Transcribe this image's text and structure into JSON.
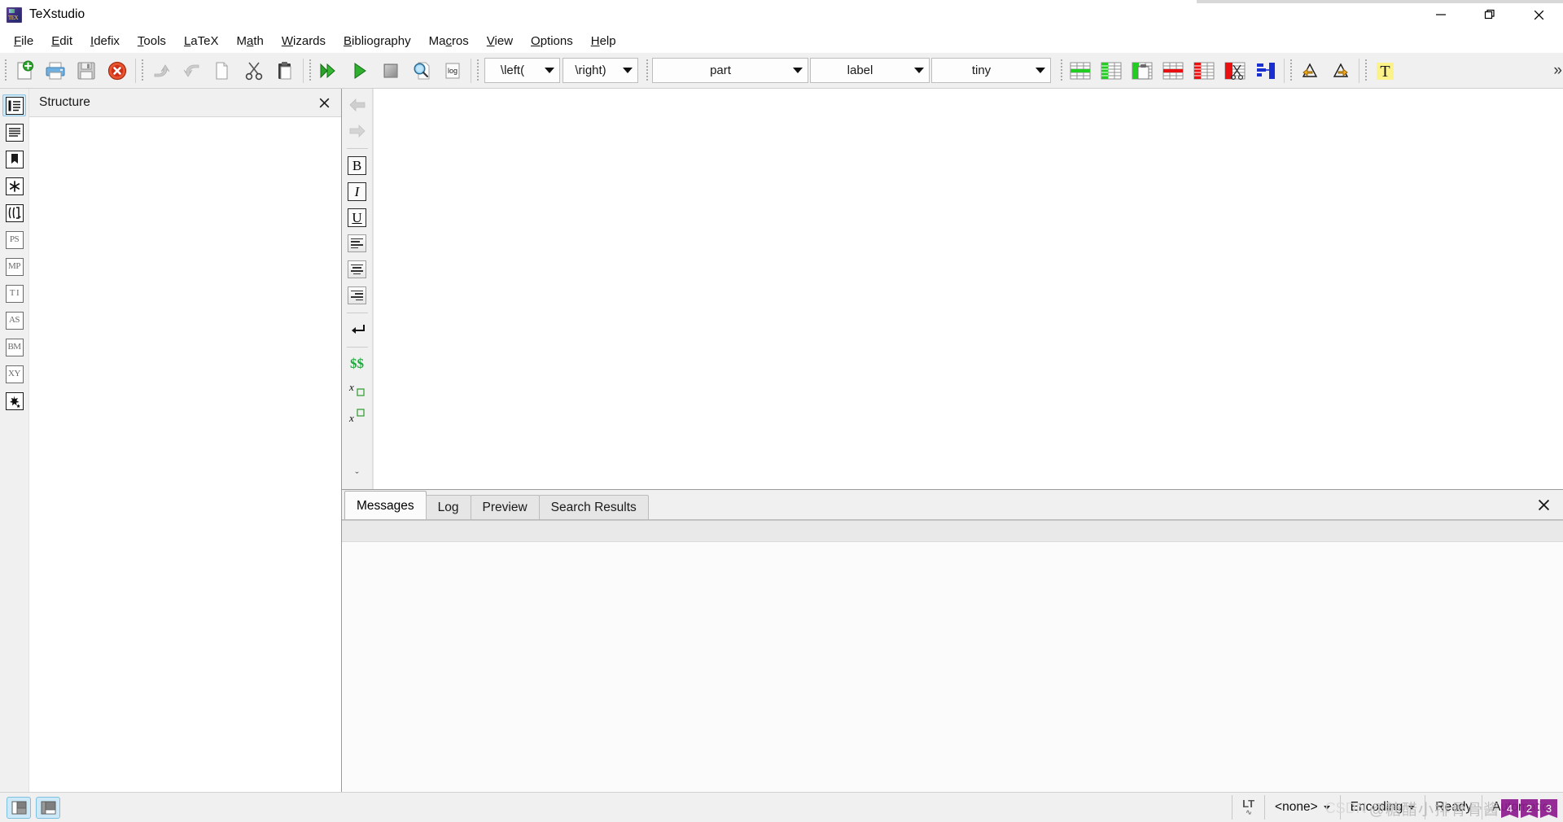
{
  "window": {
    "title": "TeXstudio",
    "app_icon": "texstudio-logo-icon",
    "controls": {
      "minimize": "minimize-icon",
      "restore": "restore-icon",
      "close": "close-icon"
    }
  },
  "menubar": {
    "items": [
      {
        "label": "File",
        "mnemonic": "F"
      },
      {
        "label": "Edit",
        "mnemonic": "E"
      },
      {
        "label": "Idefix",
        "mnemonic": "I"
      },
      {
        "label": "Tools",
        "mnemonic": "T"
      },
      {
        "label": "LaTeX",
        "mnemonic": "L"
      },
      {
        "label": "Math",
        "mnemonic": "a"
      },
      {
        "label": "Wizards",
        "mnemonic": "W"
      },
      {
        "label": "Bibliography",
        "mnemonic": "B"
      },
      {
        "label": "Macros",
        "mnemonic": "c"
      },
      {
        "label": "View",
        "mnemonic": "V"
      },
      {
        "label": "Options",
        "mnemonic": "O"
      },
      {
        "label": "Help",
        "mnemonic": "H"
      }
    ]
  },
  "toolbar": {
    "groups": [
      {
        "name": "file-group",
        "buttons": [
          {
            "name": "new-document-button",
            "icon": "new-document-icon",
            "tooltip": "New"
          },
          {
            "name": "print-button",
            "icon": "printer-icon",
            "tooltip": "Print"
          },
          {
            "name": "save-button",
            "icon": "floppy-save-icon",
            "tooltip": "Save"
          },
          {
            "name": "close-document-button",
            "icon": "red-close-circle-icon",
            "tooltip": "Close"
          }
        ]
      },
      {
        "name": "edit-group",
        "buttons": [
          {
            "name": "undo-button",
            "icon": "undo-arrow-icon",
            "tooltip": "Undo",
            "disabled": true
          },
          {
            "name": "redo-button",
            "icon": "redo-arrow-icon",
            "tooltip": "Redo",
            "disabled": true
          },
          {
            "name": "copy-button",
            "icon": "copy-pages-icon",
            "tooltip": "Copy"
          },
          {
            "name": "cut-button",
            "icon": "scissors-icon",
            "tooltip": "Cut"
          },
          {
            "name": "paste-button",
            "icon": "clipboard-paste-icon",
            "tooltip": "Paste"
          }
        ]
      },
      {
        "name": "build-group",
        "buttons": [
          {
            "name": "build-and-view-button",
            "icon": "double-green-arrow-icon",
            "tooltip": "Build & View"
          },
          {
            "name": "compile-button",
            "icon": "green-play-arrow-icon",
            "tooltip": "Compile"
          },
          {
            "name": "stop-button",
            "icon": "gray-stop-square-icon",
            "tooltip": "Stop"
          },
          {
            "name": "view-log-button",
            "icon": "magnifier-page-icon",
            "tooltip": "View Log"
          },
          {
            "name": "log-button",
            "icon": "log-page-icon",
            "tooltip": "Log",
            "label": "log"
          }
        ]
      }
    ],
    "combos": [
      {
        "name": "left-bracket-combo",
        "value": "\\left(",
        "size": "sm"
      },
      {
        "name": "right-bracket-combo",
        "value": "\\right)",
        "size": "sm"
      },
      {
        "name": "section-level-combo",
        "value": "part",
        "size": "lg"
      },
      {
        "name": "label-combo",
        "value": "label",
        "size": "md"
      },
      {
        "name": "font-size-combo",
        "value": "tiny",
        "size": "md"
      }
    ],
    "table_buttons": [
      {
        "name": "insert-table-row-button",
        "icon": "table-green-row-icon"
      },
      {
        "name": "insert-table-column-button",
        "icon": "table-green-column-icon"
      },
      {
        "name": "paste-table-column-button",
        "icon": "table-green-column-paste-icon"
      },
      {
        "name": "remove-table-row-button",
        "icon": "table-red-row-icon"
      },
      {
        "name": "remove-table-column-button",
        "icon": "table-red-column-icon"
      },
      {
        "name": "cut-table-column-button",
        "icon": "table-red-column-scissors-icon"
      },
      {
        "name": "align-table-columns-button",
        "icon": "table-blue-align-icon"
      }
    ],
    "delta_buttons": [
      {
        "name": "previous-change-button",
        "icon": "triangle-left-arrow-icon"
      },
      {
        "name": "next-change-button",
        "icon": "triangle-right-arrow-icon"
      }
    ],
    "highlight_button": {
      "name": "text-highlight-button",
      "icon": "yellow-highlight-T-icon",
      "label": "T"
    },
    "overflow": {
      "name": "toolbar-overflow-button",
      "label": "»"
    }
  },
  "rail": {
    "items": [
      {
        "name": "sidebar-structure-view",
        "icon": "structure-list-icon",
        "label": "",
        "selected": true
      },
      {
        "name": "sidebar-text-lines-view",
        "icon": "text-lines-icon",
        "label": ""
      },
      {
        "name": "sidebar-bookmarks-view",
        "icon": "bookmark-icon",
        "label": ""
      },
      {
        "name": "sidebar-symbols-view",
        "icon": "asterisk-symbol-icon",
        "label": "✱"
      },
      {
        "name": "sidebar-brackets-view",
        "icon": "brackets-icon",
        "label": "(⟦·"
      },
      {
        "name": "sidebar-ps-symbols",
        "icon": "ps-symbols-icon",
        "label": "PS"
      },
      {
        "name": "sidebar-mp-symbols",
        "icon": "mp-symbols-icon",
        "label": "MP"
      },
      {
        "name": "sidebar-ti-symbols",
        "icon": "ti-symbols-icon",
        "label": "T I"
      },
      {
        "name": "sidebar-as-symbols",
        "icon": "as-symbols-icon",
        "label": "AS"
      },
      {
        "name": "sidebar-bm-symbols",
        "icon": "bm-symbols-icon",
        "label": "BM"
      },
      {
        "name": "sidebar-xy-symbols",
        "icon": "xy-symbols-icon",
        "label": "XY"
      },
      {
        "name": "sidebar-favorite-symbols",
        "icon": "star-sparkle-icon",
        "label": ""
      }
    ]
  },
  "structure_panel": {
    "title": "Structure",
    "close_icon": "close-icon",
    "items": []
  },
  "format_toolbar": {
    "buttons": [
      {
        "name": "navigate-back-button",
        "icon": "back-arrow-icon",
        "disabled": true
      },
      {
        "name": "navigate-forward-button",
        "icon": "forward-arrow-icon",
        "disabled": true
      },
      {
        "name": "bold-button",
        "icon": "bold-icon",
        "label": "B"
      },
      {
        "name": "italic-button",
        "icon": "italic-icon",
        "label": "I"
      },
      {
        "name": "underline-button",
        "icon": "underline-icon",
        "label": "U"
      },
      {
        "name": "align-left-button",
        "icon": "align-left-icon"
      },
      {
        "name": "align-center-button",
        "icon": "align-center-icon"
      },
      {
        "name": "align-right-button",
        "icon": "align-right-icon"
      },
      {
        "name": "insert-newline-button",
        "icon": "return-arrow-icon"
      },
      {
        "name": "inline-math-button",
        "icon": "dollar-dollar-icon",
        "label": "$$"
      },
      {
        "name": "subscript-button",
        "icon": "subscript-icon",
        "label": "x□"
      },
      {
        "name": "superscript-button",
        "icon": "superscript-icon",
        "label": "x□"
      },
      {
        "name": "expand-format-toolbar-button",
        "icon": "chevron-down-icon",
        "label": "ˇ"
      }
    ]
  },
  "message_panel": {
    "tabs": [
      {
        "name": "tab-messages",
        "label": "Messages",
        "active": true
      },
      {
        "name": "tab-log",
        "label": "Log",
        "active": false
      },
      {
        "name": "tab-preview",
        "label": "Preview",
        "active": false
      },
      {
        "name": "tab-search-results",
        "label": "Search Results",
        "active": false
      }
    ],
    "close_icon": "close-icon",
    "content": ""
  },
  "statusbar": {
    "layout_buttons": [
      {
        "name": "toggle-structure-panel-button",
        "icon": "layout-left-panel-icon",
        "active": true
      },
      {
        "name": "toggle-message-panel-button",
        "icon": "layout-bottom-panel-icon",
        "active": true
      }
    ],
    "items": [
      {
        "name": "status-languagetool",
        "label": "LT",
        "sub": "∿",
        "icon": "languagetool-icon"
      },
      {
        "name": "status-spellcheck-language",
        "label": "<none>",
        "caret": true
      },
      {
        "name": "status-encoding",
        "label": "Encoding",
        "caret": true
      },
      {
        "name": "status-ready",
        "label": "Ready",
        "caret": false
      },
      {
        "name": "status-automatic",
        "label": "Automatic",
        "caret": false
      }
    ]
  },
  "watermark": {
    "site": "CSDN",
    "handle": "@糖醋小排骨骨酱",
    "badges": [
      "4",
      "2",
      "3"
    ]
  },
  "colors": {
    "window_bg": "#f0f0f0",
    "editor_bg": "#ffffff",
    "accent_selected": "#cde8f7",
    "green": "#2bb02b",
    "red": "#e02020",
    "blue": "#2040d0",
    "highlight_yellow": "#fbf28a"
  }
}
